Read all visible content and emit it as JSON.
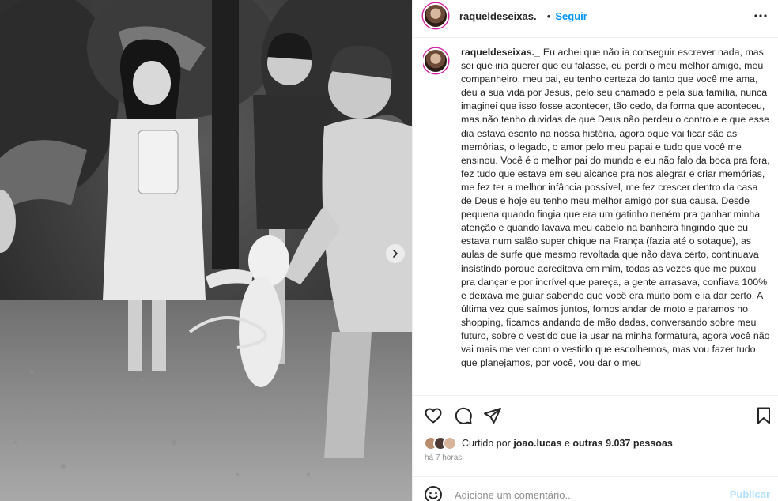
{
  "post": {
    "username": "raqueldeseixas._",
    "separator": "•",
    "follow_label": "Seguir",
    "caption": "Eu achei que não ia conseguir escrever nada, mas sei que iria querer que eu falasse, eu perdi o meu melhor amigo, meu companheiro, meu pai, eu tenho certeza do tanto que você me ama, deu a sua vida por Jesus, pelo seu chamado e pela sua família, nunca imaginei que isso fosse acontecer, tão cedo, da forma que aconteceu, mas não tenho duvidas de que Deus não perdeu o controle e que esse dia estava escrito na nossa história, agora oque vai ficar são as memórias, o legado, o amor pelo meu papai e tudo que você me ensinou. Você é o melhor pai do mundo e eu não falo da boca pra fora, fez tudo que estava em seu alcance pra nos alegrar e criar memórias, me fez ter a melhor infância possível, me fez crescer dentro da casa de Deus e hoje eu tenho meu melhor amigo por sua causa. Desde pequena quando fingia que era um gatinho neném pra ganhar minha atenção e quando lavava meu cabelo na banheira fingindo que eu estava num salão super chique na França (fazia até o sotaque), as aulas de surfe que mesmo revoltada que não dava certo, continuava insistindo porque acreditava em mim, todas as vezes que me puxou pra dançar e por incrível que pareça, a gente arrasava, confiava 100% e deixava me guiar sabendo que você era muito bom e ia dar certo. A última vez que saímos juntos, fomos andar de moto e paramos no shopping, ficamos andando de mão dadas, conversando sobre meu futuro, sobre o vestido que ia usar na minha formatura, agora você não vai mais me ver com o vestido que escolhemos, mas vou fazer tudo que planejamos, por você, vou dar o meu",
    "likes_prefix": "Curtido por",
    "likes_user": "joao.lucas",
    "likes_connector": "e",
    "likes_others": "outras 9.037 pessoas",
    "timestamp": "há 7 horas",
    "comment_placeholder": "Adicione um comentário...",
    "publish_label": "Publicar"
  },
  "icons": {
    "more": "more-horizontal-icon",
    "like": "heart-icon",
    "comment": "comment-icon",
    "share": "send-icon",
    "save": "bookmark-icon",
    "emoji": "emoji-icon",
    "carousel_next": "chevron-right-icon"
  },
  "colors": {
    "accent": "#0095f6",
    "text": "#262626",
    "muted": "#8e8e8e",
    "publish_disabled": "#b2dffc",
    "story_ring": "#d6249f"
  }
}
